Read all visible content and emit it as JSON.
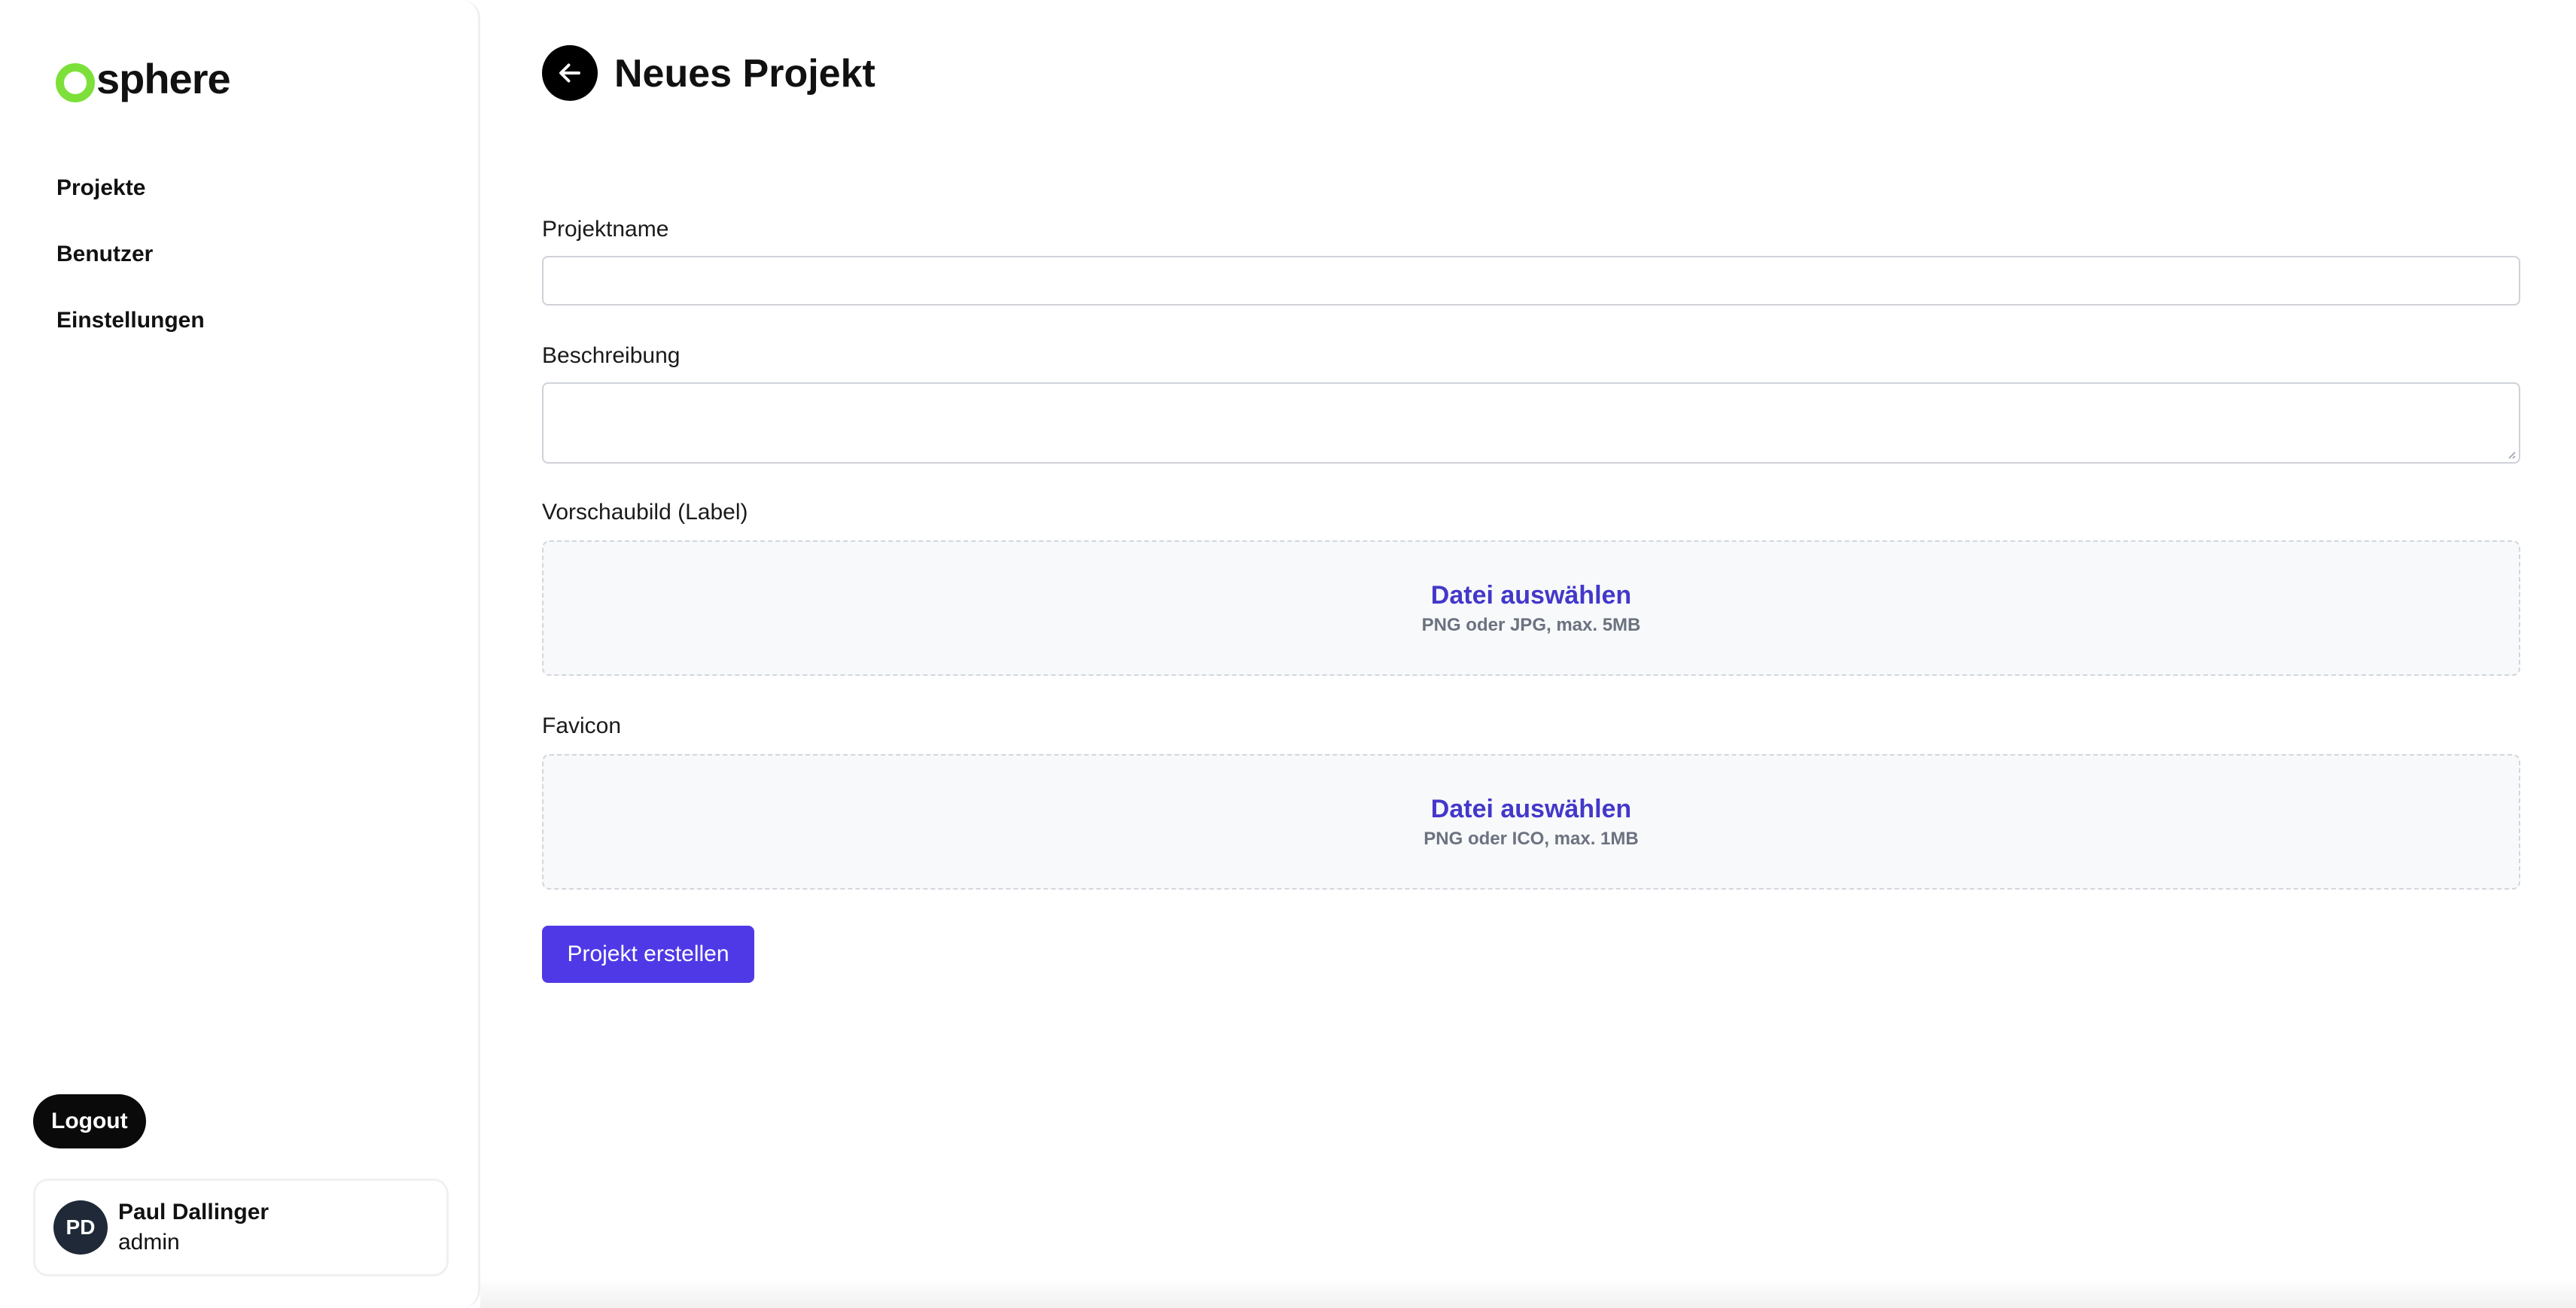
{
  "brand": {
    "logo_text": "sphere",
    "accent_color": "#7de03a"
  },
  "sidebar": {
    "items": [
      {
        "label": "Projekte"
      },
      {
        "label": "Benutzer"
      },
      {
        "label": "Einstellungen"
      }
    ],
    "logout_label": "Logout",
    "user": {
      "initials": "PD",
      "name": "Paul Dallinger",
      "role": "admin"
    }
  },
  "header": {
    "title": "Neues Projekt",
    "back_icon": "arrow-left-icon"
  },
  "form": {
    "project_name": {
      "label": "Projektname",
      "value": ""
    },
    "description": {
      "label": "Beschreibung",
      "value": ""
    },
    "preview_image": {
      "label": "Vorschaubild (Label)",
      "action": "Datei auswählen",
      "hint": "PNG oder JPG, max. 5MB"
    },
    "favicon": {
      "label": "Favicon",
      "action": "Datei auswählen",
      "hint": "PNG oder ICO, max. 1MB"
    },
    "submit_label": "Projekt erstellen"
  },
  "colors": {
    "primary": "#4f39e6",
    "link": "#4338ca",
    "dark": "#0a0a0a"
  }
}
